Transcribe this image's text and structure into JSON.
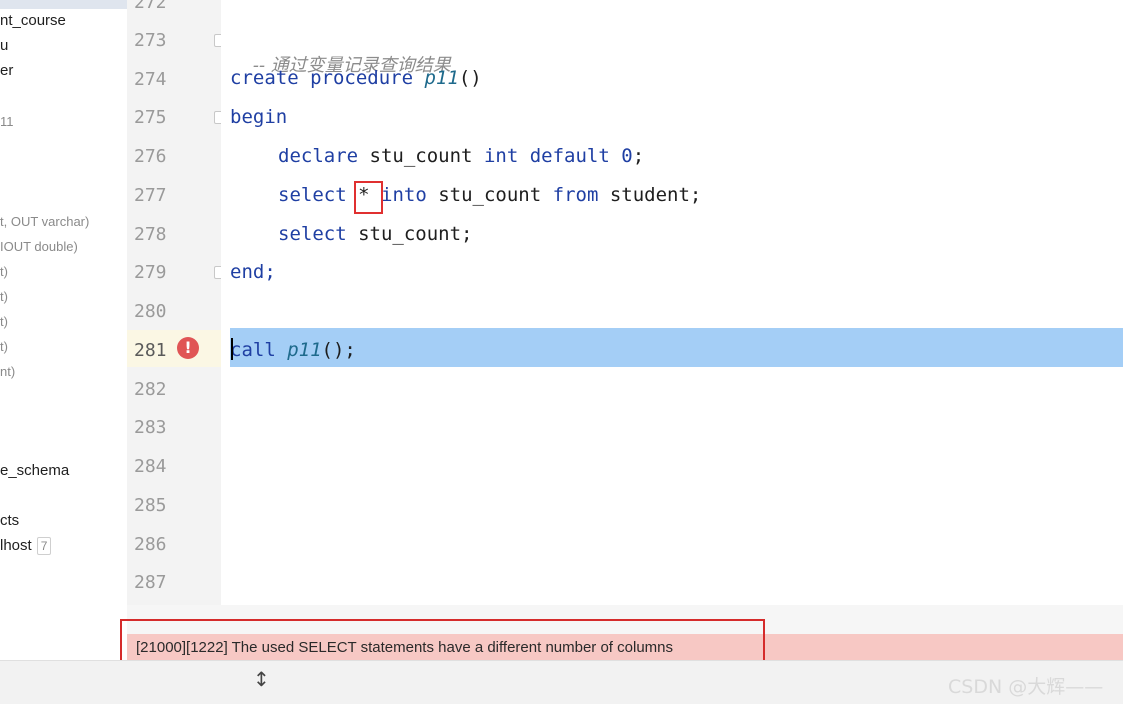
{
  "sidebar": {
    "items": [
      {
        "label": "nt_course"
      },
      {
        "label": "u"
      },
      {
        "label": "er"
      },
      {
        "label": "11"
      },
      {
        "label": "t, OUT varchar)"
      },
      {
        "label": "IOUT double)"
      },
      {
        "label": "t)"
      },
      {
        "label": "t)"
      },
      {
        "label": "t)"
      },
      {
        "label": "t)"
      },
      {
        "label": "nt)"
      },
      {
        "label": "e_schema"
      },
      {
        "label": "cts"
      },
      {
        "label": "lhost",
        "badge": "7"
      }
    ]
  },
  "gutter": {
    "lines": [
      "272",
      "273",
      "274",
      "275",
      "276",
      "277",
      "278",
      "279",
      "280",
      "281",
      "282",
      "283",
      "284",
      "285",
      "286",
      "287"
    ],
    "current_line": "281"
  },
  "editor": {
    "comment": "-- 通过变量记录查询结果",
    "line274": {
      "kw": "create procedure",
      "name": "p11",
      "rest": "()"
    },
    "line275": "begin",
    "line276": {
      "kw1": "declare",
      "var": "stu_count",
      "kw2": "int default",
      "num": "0",
      "end": ";"
    },
    "line277": {
      "kw1": "select",
      "star": "*",
      "kw2": "into",
      "var": "stu_count",
      "kw3": "from",
      "table": "student;"
    },
    "line278": {
      "kw": "select",
      "rest": "stu_count;"
    },
    "line279": "end;",
    "line281": {
      "kw": "call",
      "name": "p11",
      "rest": "();"
    }
  },
  "error": {
    "message": "[21000][1222] The used SELECT statements have a different number of columns"
  },
  "watermark": "CSDN @大辉——",
  "colors": {
    "keyword": "#1f3fa3",
    "highlight": "#a4cef6",
    "error_bar": "#f7c8c4",
    "annotation_box": "#d52b2b"
  }
}
